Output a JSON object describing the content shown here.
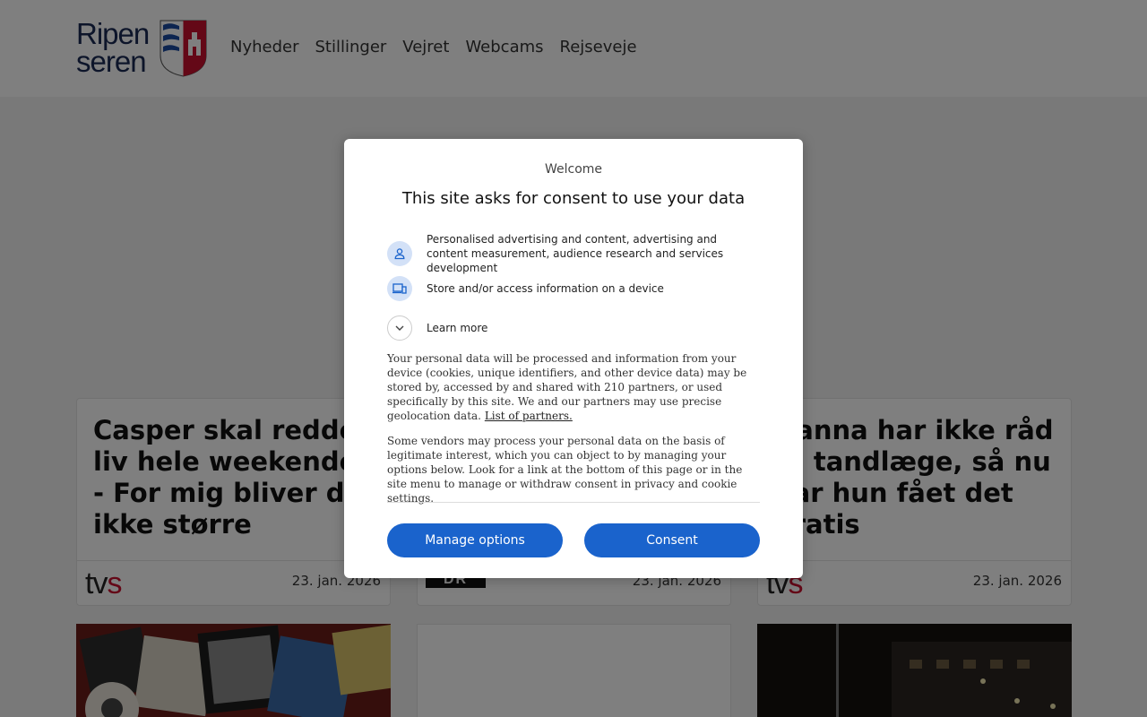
{
  "header": {
    "logo_text_line1": "Ripen",
    "logo_text_line2": "seren",
    "nav": [
      "Nyheder",
      "Stillinger",
      "Vejret",
      "Webcams",
      "Rejseveje"
    ]
  },
  "cards": [
    {
      "title": "Casper skal redde liv hele weekenden: - For mig bliver det ikke større",
      "source": "tvs",
      "date": "23. jan. 2026"
    },
    {
      "title": "",
      "source": "DR",
      "date": "23. jan. 2026"
    },
    {
      "title": "Hanna har ikke råd til tandlæge, så nu har hun fået det gratis",
      "source": "tvs",
      "date": "23. jan. 2026"
    }
  ],
  "source_labels": {
    "tvs_tv": "tv",
    "tvs_s": "s",
    "dr": "DR"
  },
  "consent": {
    "welcome": "Welcome",
    "title": "This site asks for consent to use your data",
    "purposes": [
      {
        "icon": "person-icon",
        "text": "Personalised advertising and content, advertising and content measurement, audience research and services development"
      },
      {
        "icon": "devices-icon",
        "text": "Store and/or access information on a device"
      }
    ],
    "learn_more": "Learn more",
    "paragraph1": "Your personal data will be processed and information from your device (cookies, unique identifiers, and other device data) may be stored by, accessed by and shared with 210 partners, or used specifically by this site. We and our partners may use precise geolocation data.",
    "partners_link": "List of partners.",
    "paragraph2": "Some vendors may process your personal data on the basis of legitimate interest, which you can object to by managing your options below. Look for a link at the bottom of this page or in the site menu to manage or withdraw consent in privacy and cookie settings.",
    "manage_button": "Manage options",
    "consent_button": "Consent"
  },
  "colors": {
    "accent": "#1a63cc",
    "icon_bg": "#d3e1f7",
    "overlay": "rgba(0,0,0,0.5)",
    "tvs_red": "#c8102e"
  }
}
